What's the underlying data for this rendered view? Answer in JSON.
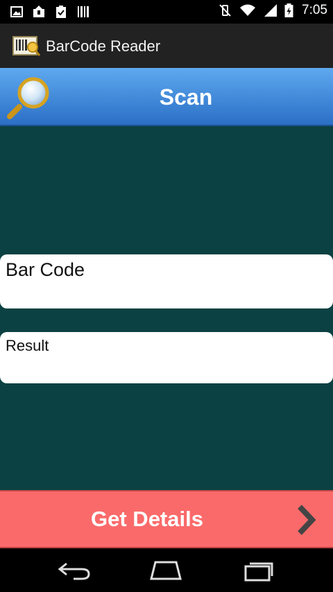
{
  "status_bar": {
    "time": "7:05",
    "left_icons": [
      "image-icon",
      "upload-icon",
      "clipboard-check-icon",
      "barcode-status-icon"
    ],
    "right_icons": [
      "vibrate-off-icon",
      "wifi-icon",
      "signal-icon",
      "battery-icon"
    ]
  },
  "action_bar": {
    "title": "BarCode Reader",
    "icon": "barcode-app-icon"
  },
  "scan_button": {
    "label": "Scan",
    "icon": "magnifier-icon"
  },
  "barcode_field": {
    "label": "Bar Code"
  },
  "result_field": {
    "label": "Result"
  },
  "details_button": {
    "label": "Get Details",
    "icon": "chevron-right-icon"
  },
  "nav_bar": {
    "buttons": [
      "back-icon",
      "home-icon",
      "recents-icon"
    ]
  },
  "colors": {
    "background": "#0b4142",
    "scan_button": "#3d87d9",
    "details_button": "#fa6a6a",
    "status_bar": "#000000",
    "action_bar": "#222222"
  }
}
